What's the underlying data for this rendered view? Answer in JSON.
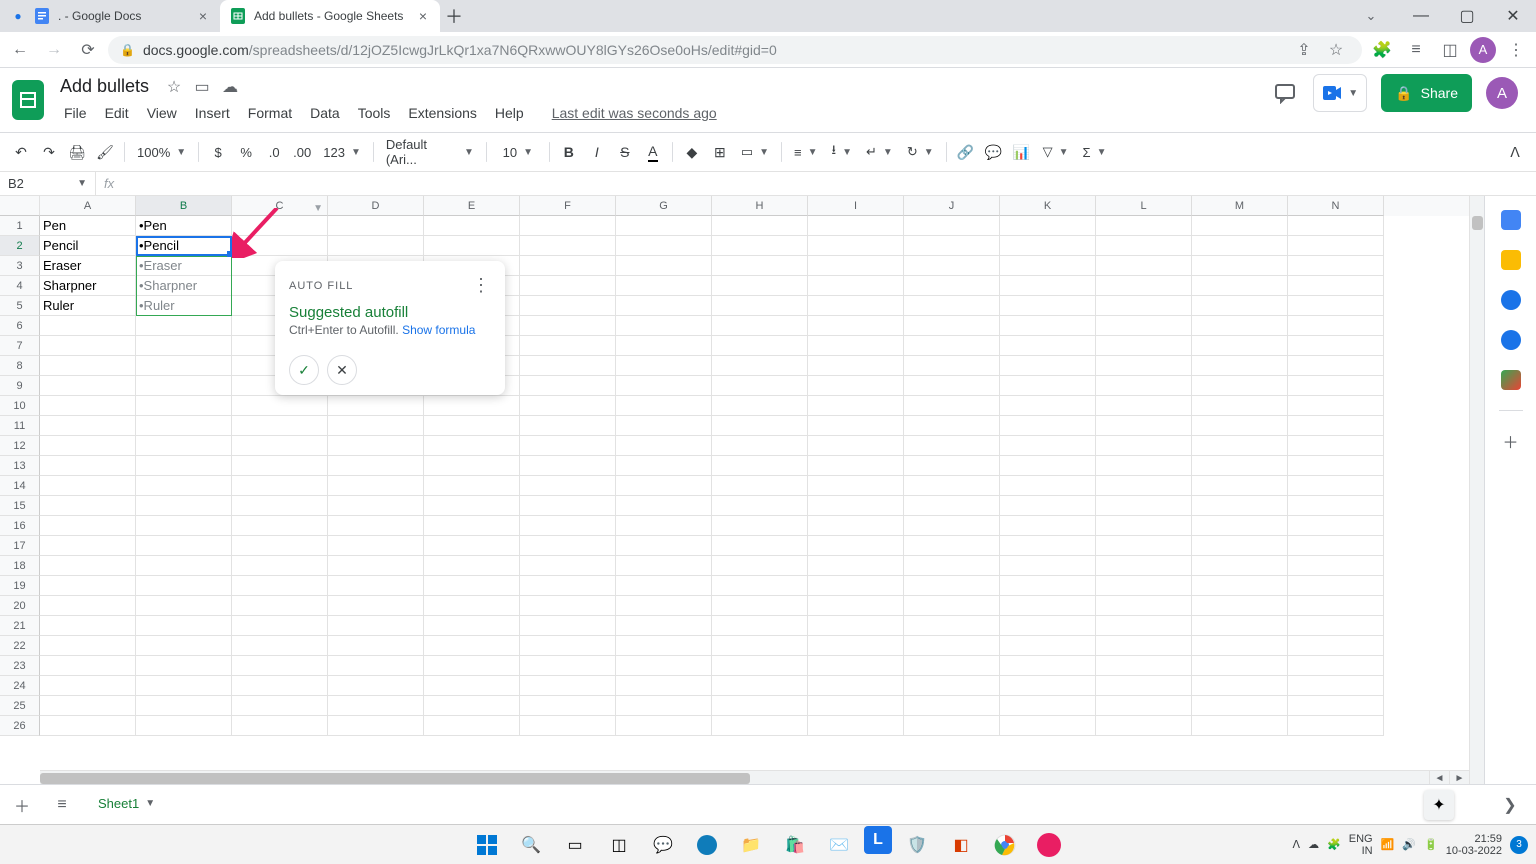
{
  "browser": {
    "tabs": [
      {
        "title": ". - Google Docs"
      },
      {
        "title": "Add bullets - Google Sheets"
      }
    ],
    "url_prefix": "docs.google.com",
    "url_rest": "/spreadsheets/d/12jOZ5IcwgJrLkQr1xa7N6QRxwwOUY8lGYs26Ose0oHs/edit#gid=0",
    "avatar_letter": "A"
  },
  "doc": {
    "name": "Add bullets",
    "last_edit": "Last edit was seconds ago",
    "share_label": "Share",
    "avatar_letter": "A"
  },
  "menus": [
    "File",
    "Edit",
    "View",
    "Insert",
    "Format",
    "Data",
    "Tools",
    "Extensions",
    "Help"
  ],
  "toolbar": {
    "zoom": "100%",
    "font": "Default (Ari...",
    "font_size": "10",
    "num_format": "123"
  },
  "name_box": "B2",
  "columns": [
    "A",
    "B",
    "C",
    "D",
    "E",
    "F",
    "G",
    "H",
    "I",
    "J",
    "K",
    "L",
    "M",
    "N"
  ],
  "rows_count": 26,
  "selected_row": 2,
  "selected_col": 1,
  "cell_data": {
    "A": [
      "Pen",
      "Pencil",
      "Eraser",
      "Sharpner",
      "Ruler"
    ],
    "B": [
      "•Pen",
      "•Pencil",
      "•Eraser",
      "•Sharpner",
      "•Ruler"
    ]
  },
  "autofill": {
    "title": "AUTO FILL",
    "suggested": "Suggested autofill",
    "hint": "Ctrl+Enter to Autofill. ",
    "link": "Show formula"
  },
  "sheet_tab": "Sheet1",
  "tray": {
    "lang1": "ENG",
    "lang2": "IN",
    "time": "21:59",
    "date": "10-03-2022"
  }
}
